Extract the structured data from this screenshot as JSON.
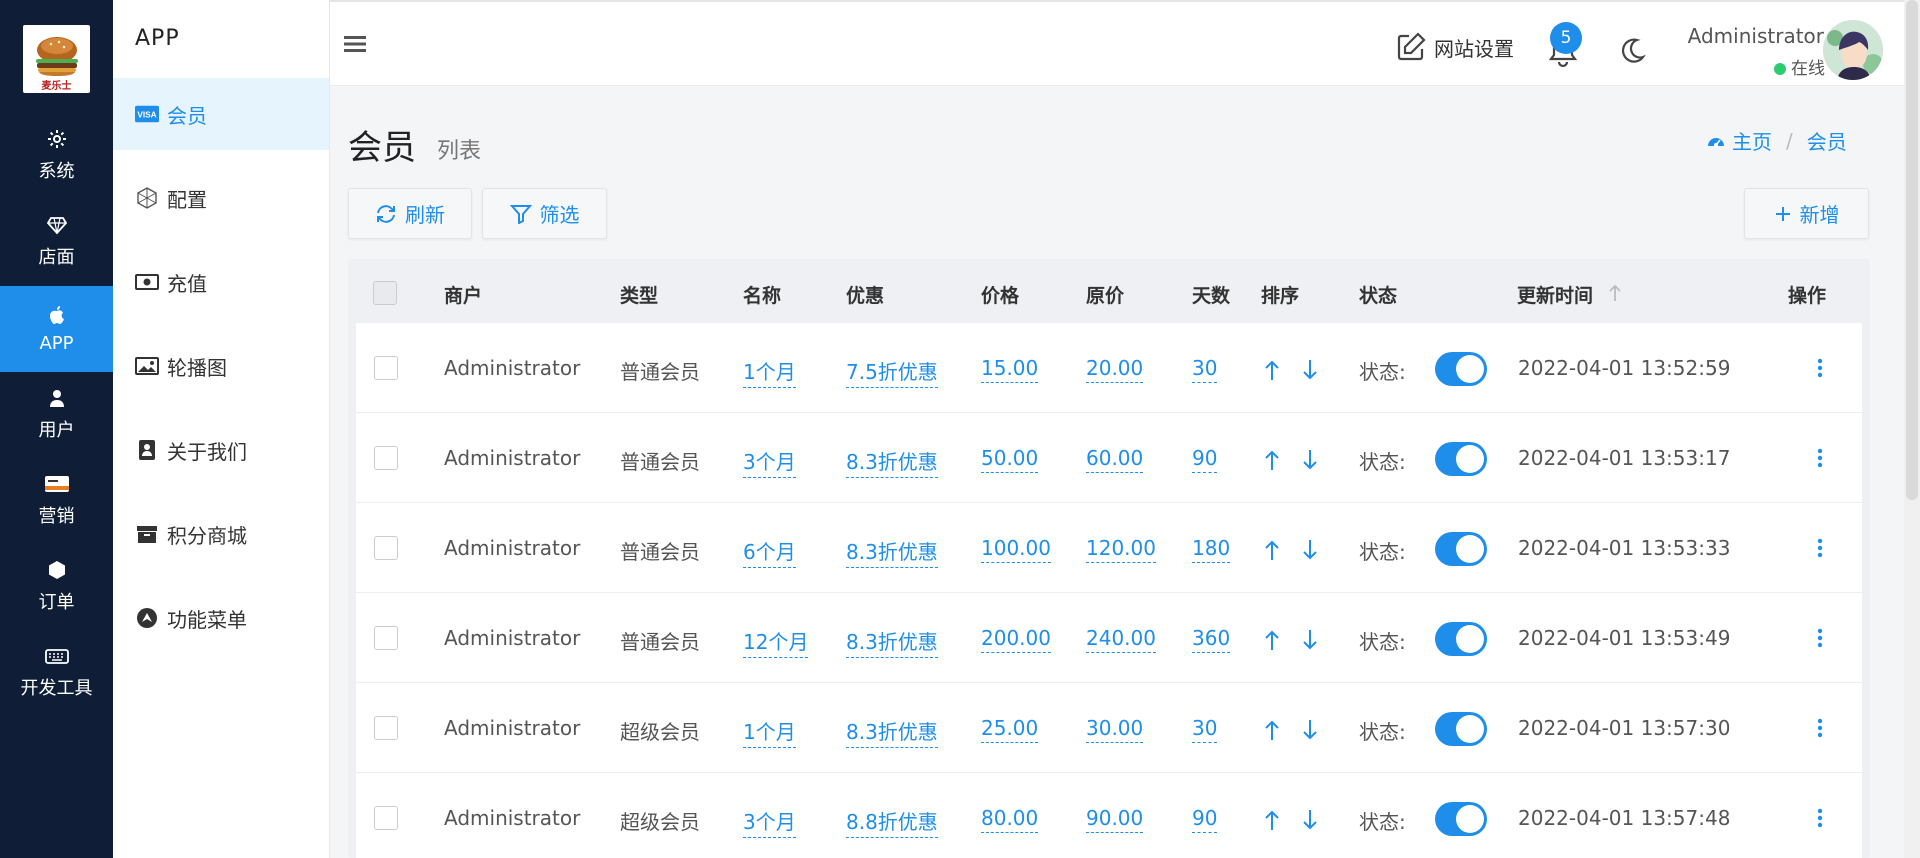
{
  "rail": {
    "logo_text": "麦乐士",
    "items": [
      {
        "label": "系统",
        "icon": "gear-icon"
      },
      {
        "label": "店面",
        "icon": "diamond-icon"
      },
      {
        "label": "APP",
        "icon": "apple-icon"
      },
      {
        "label": "用户",
        "icon": "user-icon"
      },
      {
        "label": "营销",
        "icon": "card-icon"
      },
      {
        "label": "订单",
        "icon": "hexagon-icon"
      },
      {
        "label": "开发工具",
        "icon": "keyboard-icon"
      }
    ],
    "active": "APP"
  },
  "subnav": {
    "title": "APP",
    "items": [
      {
        "label": "会员",
        "icon": "visa-card-icon"
      },
      {
        "label": "配置",
        "icon": "hexagon-grid-icon"
      },
      {
        "label": "充值",
        "icon": "money-icon"
      },
      {
        "label": "轮播图",
        "icon": "image-icon"
      },
      {
        "label": "关于我们",
        "icon": "contact-book-icon"
      },
      {
        "label": "积分商城",
        "icon": "archive-icon"
      },
      {
        "label": "功能菜单",
        "icon": "compass-icon"
      }
    ],
    "active": "会员"
  },
  "header": {
    "site_settings": "网站设置",
    "notification_count": "5",
    "user_name": "Administrator",
    "user_status": "在线"
  },
  "page": {
    "title": "会员",
    "subtitle": "列表",
    "breadcrumb": [
      "主页",
      "会员"
    ]
  },
  "toolbar": {
    "refresh": "刷新",
    "filter": "筛选",
    "add": "新增"
  },
  "table": {
    "columns": [
      "商户",
      "类型",
      "名称",
      "优惠",
      "价格",
      "原价",
      "天数",
      "排序",
      "状态",
      "更新时间",
      "操作"
    ],
    "status_label": "状态:",
    "rows": [
      {
        "merchant": "Administrator",
        "type": "普通会员",
        "name": "1个月",
        "discount": "7.5折优惠",
        "price": "15.00",
        "original": "20.00",
        "days": "30",
        "enabled": true,
        "updated": "2022-04-01 13:52:59"
      },
      {
        "merchant": "Administrator",
        "type": "普通会员",
        "name": "3个月",
        "discount": "8.3折优惠",
        "price": "50.00",
        "original": "60.00",
        "days": "90",
        "enabled": true,
        "updated": "2022-04-01 13:53:17"
      },
      {
        "merchant": "Administrator",
        "type": "普通会员",
        "name": "6个月",
        "discount": "8.3折优惠",
        "price": "100.00",
        "original": "120.00",
        "days": "180",
        "enabled": true,
        "updated": "2022-04-01 13:53:33"
      },
      {
        "merchant": "Administrator",
        "type": "普通会员",
        "name": "12个月",
        "discount": "8.3折优惠",
        "price": "200.00",
        "original": "240.00",
        "days": "360",
        "enabled": true,
        "updated": "2022-04-01 13:53:49"
      },
      {
        "merchant": "Administrator",
        "type": "超级会员",
        "name": "1个月",
        "discount": "8.3折优惠",
        "price": "25.00",
        "original": "30.00",
        "days": "30",
        "enabled": true,
        "updated": "2022-04-01 13:57:30"
      },
      {
        "merchant": "Administrator",
        "type": "超级会员",
        "name": "3个月",
        "discount": "8.8折优惠",
        "price": "80.00",
        "original": "90.00",
        "days": "90",
        "enabled": true,
        "updated": "2022-04-01 13:57:48"
      }
    ]
  },
  "colors": {
    "accent": "#1e8eea",
    "rail_bg": "#0f1e36",
    "active_sub_bg": "#e6f4fd",
    "online": "#2ecc71"
  }
}
